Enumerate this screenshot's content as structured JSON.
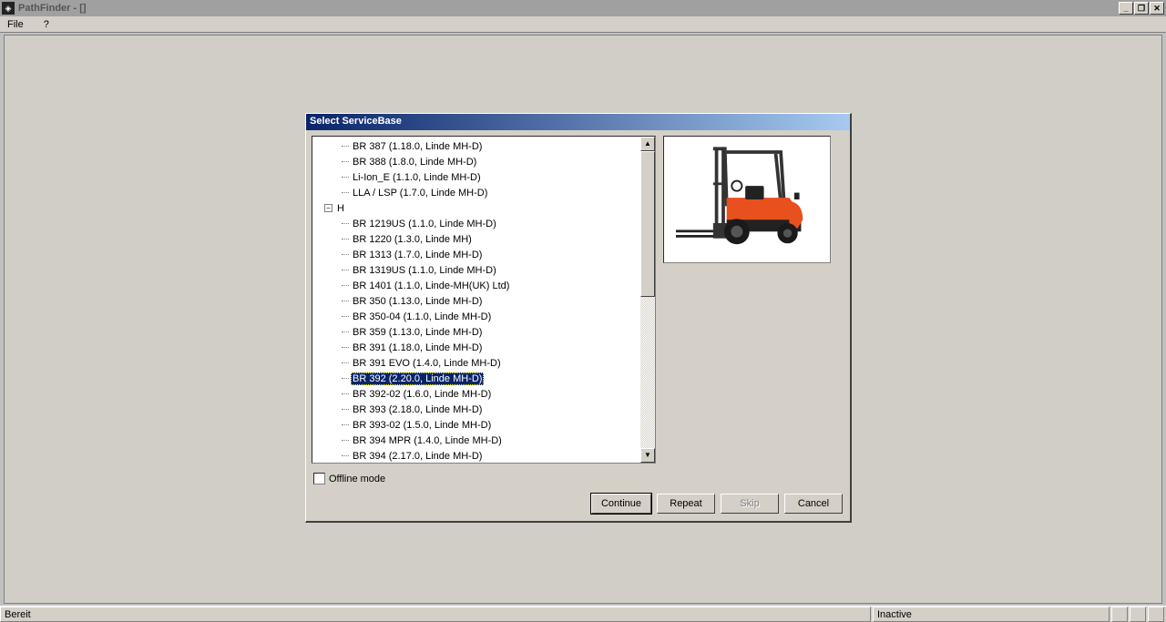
{
  "window": {
    "title": "PathFinder - []"
  },
  "menu": {
    "file": "File",
    "help": "?"
  },
  "dialog": {
    "title": "Select ServiceBase",
    "offline_label": "Offline mode",
    "buttons": {
      "continue": "Continue",
      "repeat": "Repeat",
      "skip": "Skip",
      "cancel": "Cancel"
    }
  },
  "tree": {
    "group1": [
      "BR 387 (1.18.0, Linde MH-D)",
      "BR 388 (1.8.0, Linde MH-D)",
      "Li-Ion_E (1.1.0, Linde MH-D)",
      "LLA / LSP (1.7.0, Linde MH-D)"
    ],
    "node_h": "H",
    "group2": [
      "BR 1219US (1.1.0, Linde MH-D)",
      "BR 1220 (1.3.0, Linde MH)",
      "BR 1313 (1.7.0, Linde MH-D)",
      "BR 1319US (1.1.0, Linde MH-D)",
      "BR 1401 (1.1.0, Linde-MH(UK) Ltd)",
      "BR 350 (1.13.0, Linde MH-D)",
      "BR 350-04 (1.1.0, Linde MH-D)",
      "BR 359 (1.13.0, Linde MH-D)",
      "BR 391 (1.18.0, Linde MH-D)",
      "BR 391 EVO (1.4.0, Linde MH-D)",
      "BR 392 (2.20.0, Linde MH-D)",
      "BR 392-02 (1.6.0, Linde MH-D)",
      "BR 393 (2.18.0, Linde MH-D)",
      "BR 393-02 (1.5.0, Linde MH-D)",
      "BR 394 MPR (1.4.0, Linde MH-D)",
      "BR 394 (2.17.0, Linde MH-D)"
    ],
    "selected": "BR 392 (2.20.0, Linde MH-D)"
  },
  "status": {
    "left": "Bereit",
    "right": "Inactive"
  }
}
